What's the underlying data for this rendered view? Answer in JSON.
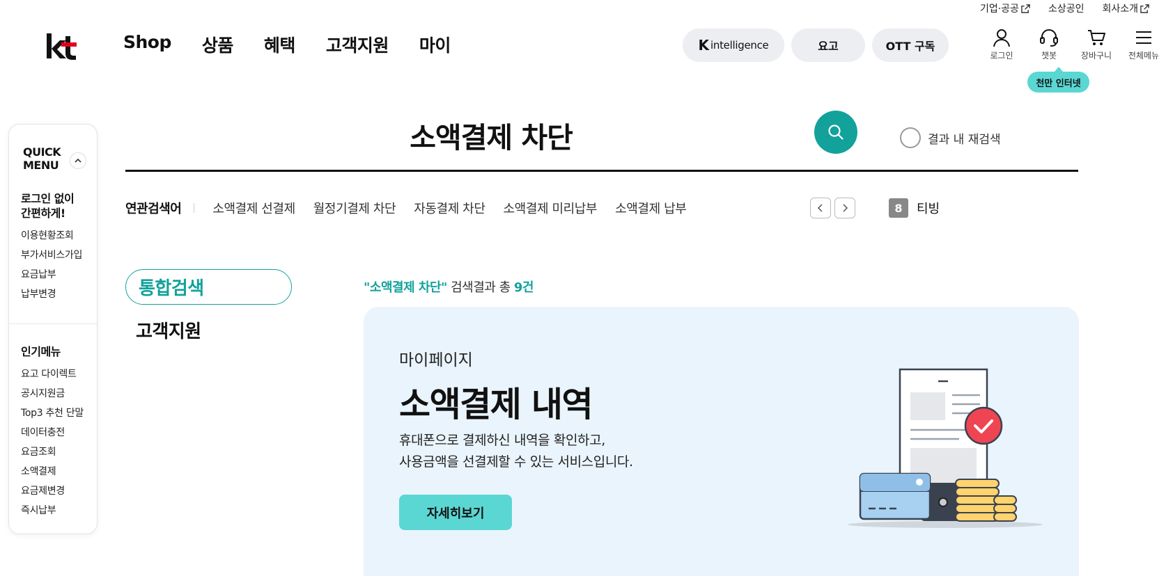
{
  "util": {
    "corporate": "기업·공공",
    "small_business": "소상공인",
    "company": "회사소개"
  },
  "header": {
    "logo_text": "kt",
    "nav": [
      "Shop",
      "상품",
      "혜택",
      "고객지원",
      "마이"
    ],
    "pills": {
      "k_intelligence_k": "K",
      "k_intelligence_text": "intelligence",
      "yogo": "요고",
      "ott": "OTT 구독"
    },
    "icons": {
      "login": "로그인",
      "chatbot": "챗봇",
      "cart": "장바구니",
      "all_menu": "전체메뉴"
    },
    "bubble": "천만 인터넷"
  },
  "quick_menu": {
    "title_line1": "QUICK",
    "title_line2": "MENU",
    "no_login_heading_line1": "로그인 없이",
    "no_login_heading_line2": "간편하게!",
    "no_login_links": [
      "이용현황조회",
      "부가서비스가입",
      "요금납부",
      "납부변경"
    ],
    "popular_heading": "인기메뉴",
    "popular_links": [
      "요고 다이렉트",
      "공시지원금",
      "Top3 추천 단말",
      "데이터충전",
      "요금조회",
      "소액결제",
      "요금제변경",
      "즉시납부"
    ]
  },
  "search": {
    "query": "소액결제 차단",
    "research_label": "결과 내 재검색"
  },
  "related": {
    "label": "연관검색어",
    "items": [
      "소액결제 선결제",
      "월정기결제 차단",
      "자동결제 차단",
      "소액결제 미리납부",
      "소액결제 납부"
    ],
    "rank_number": "8",
    "rank_term": "티빙"
  },
  "tabs": {
    "all": "통합검색",
    "customer_support": "고객지원"
  },
  "result": {
    "keyword": "\"소액결제 차단\"",
    "summary_mid": " 검색결과 총 ",
    "count": "9건",
    "card": {
      "category": "마이페이지",
      "title": "소액결제 내역",
      "desc_line1": "휴대폰으로 결제하신 내역을 확인하고,",
      "desc_line2": "사용금액을 선결제할 수 있는 서비스입니다.",
      "button": "자세히보기"
    }
  },
  "colors": {
    "accent": "#12a29b",
    "mint": "#5ad7d3",
    "kt_red": "#e4001b",
    "card_bg": "#eaf4fc"
  }
}
